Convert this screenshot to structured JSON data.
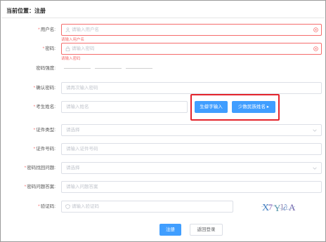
{
  "breadcrumb": "当前位置：注册",
  "form": {
    "username": {
      "label": "用户名:",
      "placeholder": "请输入用户名",
      "error": "请输入用户名"
    },
    "password": {
      "label": "密码:",
      "placeholder": "请输入密码",
      "error": "请输入密码"
    },
    "strength": {
      "label": "密码强度:"
    },
    "confirm": {
      "label": "确认密码:",
      "placeholder": "请再次输入密码"
    },
    "name": {
      "label": "考生姓名:",
      "placeholder": "请输入姓名"
    },
    "rare_char_button": "生僻字输入",
    "ethnic_name_button": "少数民族姓名",
    "id_type": {
      "label": "证件类型:",
      "placeholder": "请选择"
    },
    "id_number": {
      "label": "证件号码:",
      "placeholder": "请输入证件号码"
    },
    "security_question": {
      "label": "密码找回问题:",
      "placeholder": "请选择"
    },
    "security_answer": {
      "label": "密码问题答案:",
      "placeholder": "请输入问题答案"
    },
    "captcha": {
      "label": "验证码:",
      "placeholder": "请输入验证码",
      "image_text": "X7Y]∂A"
    }
  },
  "actions": {
    "register": "注册",
    "back_login": "返回登录"
  },
  "colors": {
    "primary": "#409eff",
    "error": "#f56c6c",
    "highlight": "#e4242c"
  },
  "icons": {
    "user": "user-icon",
    "lock": "lock-icon",
    "clear": "clear-icon",
    "arrow": "chevron-down-icon",
    "shield": "shield-icon"
  }
}
